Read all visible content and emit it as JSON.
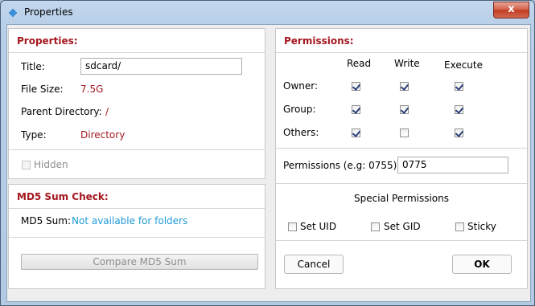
{
  "window": {
    "title": "Properties",
    "close_glyph": "x"
  },
  "properties": {
    "heading": "Properties:",
    "title_label": "Title:",
    "title_value": "sdcard/",
    "size_label": "File Size:",
    "size_value": "7.5G",
    "parent_label": "Parent Directory:",
    "parent_value": "/",
    "type_label": "Type:",
    "type_value": "Directory",
    "hidden_label": "Hidden",
    "hidden_checked": false
  },
  "md5": {
    "heading": "MD5 Sum Check:",
    "label": "MD5 Sum:",
    "value": "Not available for folders",
    "button": "Compare MD5 Sum"
  },
  "permissions": {
    "heading": "Permissions:",
    "columns": [
      "Read",
      "Write",
      "Execute"
    ],
    "rows": [
      {
        "label": "Owner:",
        "checked": [
          true,
          true,
          true
        ]
      },
      {
        "label": "Group:",
        "checked": [
          true,
          true,
          true
        ]
      },
      {
        "label": "Others:",
        "checked": [
          true,
          false,
          true
        ]
      }
    ],
    "octal_label": "Permissions (e.g: 0755):",
    "octal_value": "0775",
    "special_heading": "Special Permissions",
    "special": [
      {
        "label": "Set UID",
        "checked": false
      },
      {
        "label": "Set GID",
        "checked": false
      },
      {
        "label": "Sticky",
        "checked": false
      }
    ]
  },
  "buttons": {
    "cancel": "Cancel",
    "ok": "OK"
  },
  "colors": {
    "accent_red": "#a4171f",
    "link_blue": "#1f9bd6"
  }
}
